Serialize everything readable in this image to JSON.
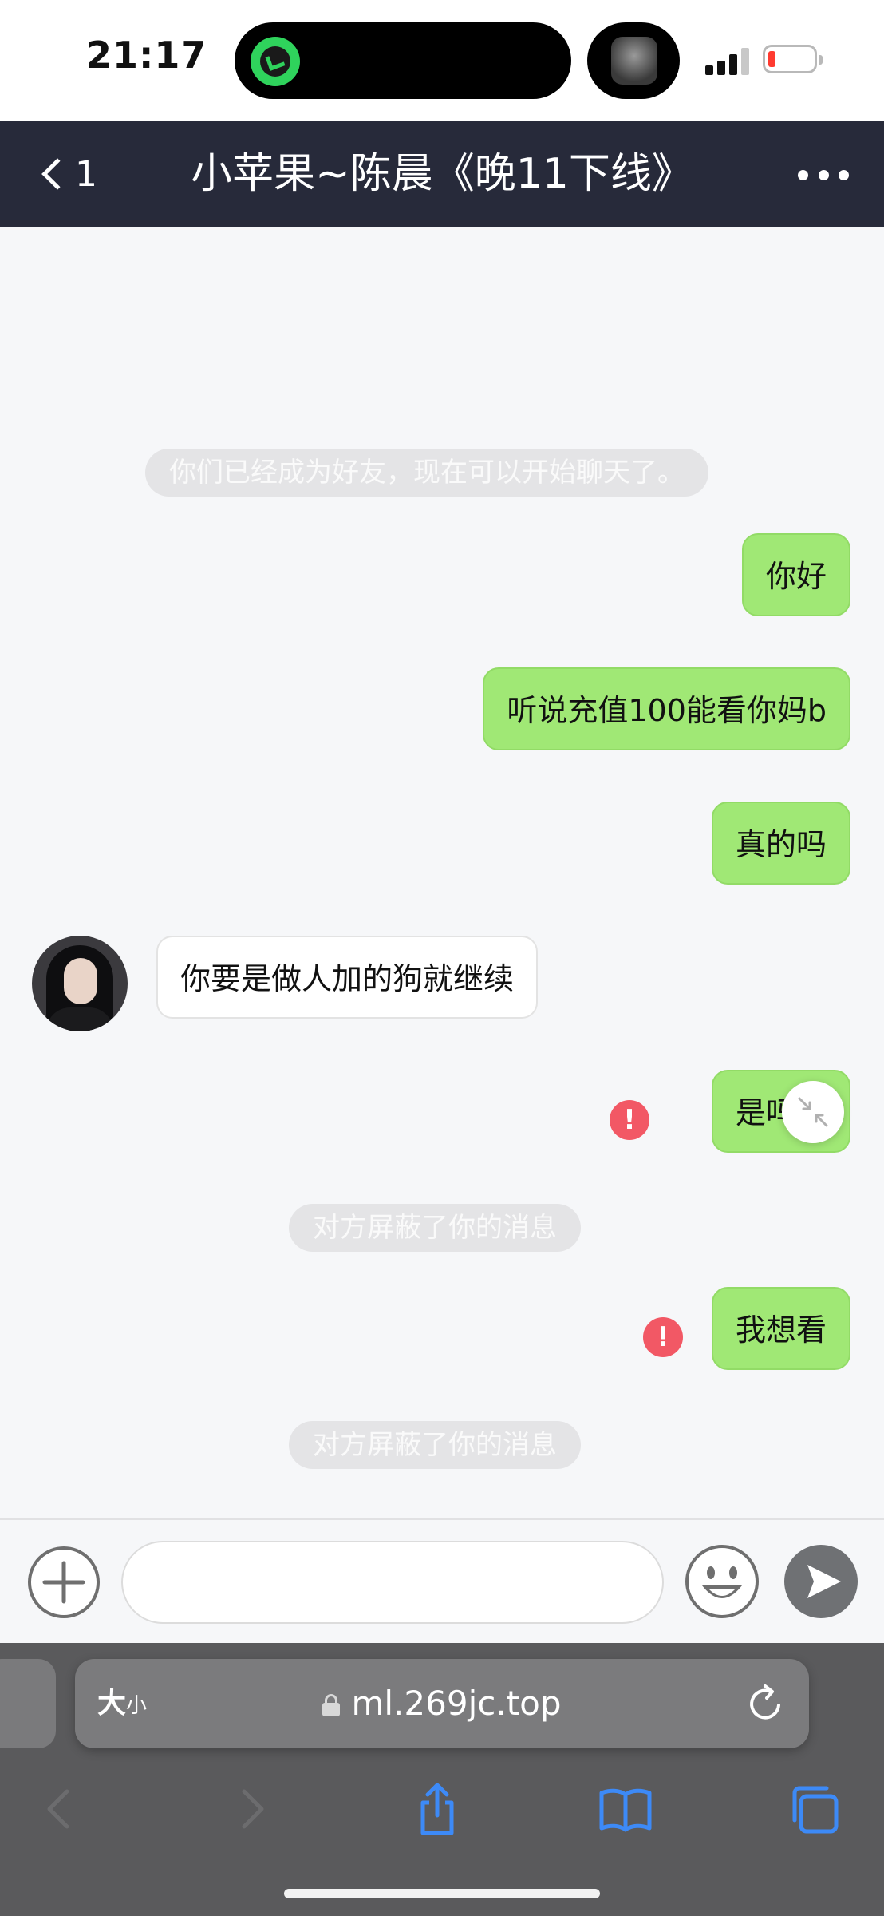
{
  "status_bar": {
    "time": "21:17"
  },
  "nav": {
    "back_count": "1",
    "title": "小苹果~陈晨《晚11下线》"
  },
  "messages": [
    {
      "type": "system",
      "text": "你们已经成为好友，现在可以开始聊天了。"
    },
    {
      "type": "outgoing",
      "text": "你好"
    },
    {
      "type": "outgoing",
      "text": "听说充值100能看你妈b"
    },
    {
      "type": "outgoing",
      "text": "真的吗"
    },
    {
      "type": "incoming",
      "text": "你要是做人加的狗就继续"
    },
    {
      "type": "outgoing",
      "text": "是吗宝",
      "failed": true
    },
    {
      "type": "system",
      "text": "对方屏蔽了你的消息"
    },
    {
      "type": "outgoing",
      "text": "我想看",
      "failed": true
    },
    {
      "type": "system",
      "text": "对方屏蔽了你的消息"
    }
  ],
  "error_mark": "!",
  "input": {
    "value": "",
    "placeholder": ""
  },
  "safari": {
    "text_size_label_large": "大",
    "text_size_label_small": "小",
    "url": "ml.269jc.top"
  },
  "colors": {
    "nav_background": "#272a3a",
    "outgoing_bubble": "#a0e875",
    "incoming_bubble": "#ffffff",
    "error_badge": "#f25865",
    "chat_background": "#f6f7f9",
    "safari_toolbar": "#5a5a5c",
    "safari_button_blue": "#3d8af7"
  },
  "icons": [
    "back-chevron-icon",
    "more-dots-icon",
    "plus-icon",
    "emoji-icon",
    "send-icon",
    "lock-icon",
    "reload-icon",
    "collapse-icon",
    "safari-back-icon",
    "safari-forward-icon",
    "share-icon",
    "bookmarks-icon",
    "tabs-icon"
  ]
}
